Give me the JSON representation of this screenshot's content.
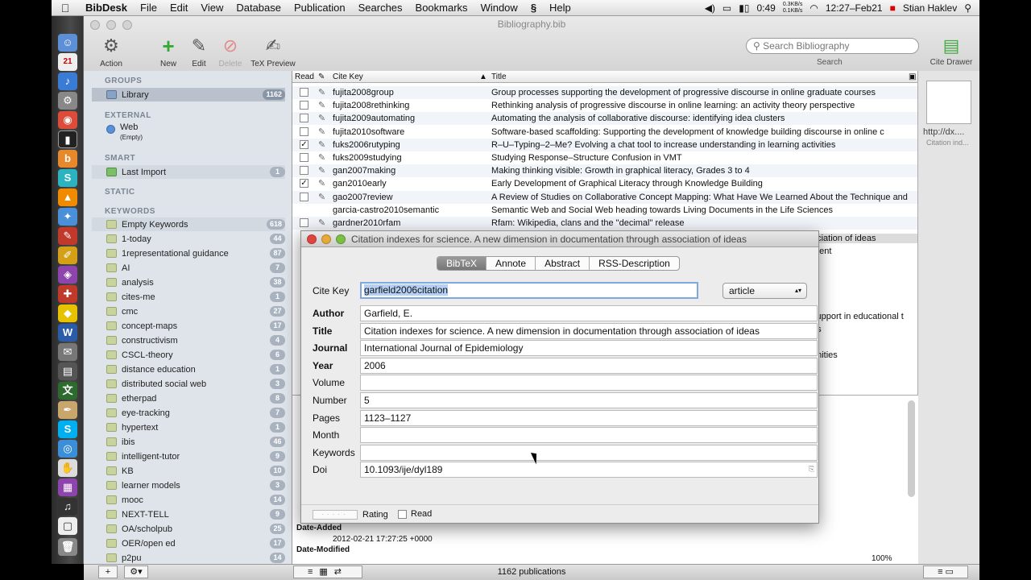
{
  "menubar": {
    "app_name": "BibDesk",
    "items": [
      "File",
      "Edit",
      "View",
      "Database",
      "Publication",
      "Searches",
      "Bookmarks",
      "Window",
      "Help"
    ],
    "battery": "0:49",
    "net_up": "0.3KB/s",
    "net_down": "0.1KB/s",
    "clock": "12:27–Feb21",
    "user": "Stian Haklev"
  },
  "window": {
    "title": "Bibliography.bib",
    "toolbar": {
      "action": "Action",
      "new": "New",
      "edit": "Edit",
      "delete": "Delete",
      "tex_preview": "TeX Preview",
      "search_placeholder": "Search Bibliography",
      "search_label": "Search",
      "cite_drawer": "Cite Drawer"
    }
  },
  "sidebar": {
    "groups_header": "GROUPS",
    "library": {
      "label": "Library",
      "count": "1162"
    },
    "external_header": "EXTERNAL",
    "web": {
      "label": "Web",
      "sub": "(Empty)"
    },
    "smart_header": "SMART",
    "last_import": {
      "label": "Last Import",
      "count": "1"
    },
    "static_header": "STATIC",
    "keywords_header": "KEYWORDS",
    "keywords": [
      {
        "label": "Empty Keywords",
        "count": "618"
      },
      {
        "label": "1-today",
        "count": "44"
      },
      {
        "label": "1representational guidance",
        "count": "87"
      },
      {
        "label": "AI",
        "count": "7"
      },
      {
        "label": "analysis",
        "count": "38"
      },
      {
        "label": "cites-me",
        "count": "1"
      },
      {
        "label": "cmc",
        "count": "27"
      },
      {
        "label": "concept-maps",
        "count": "17"
      },
      {
        "label": "constructivism",
        "count": "4"
      },
      {
        "label": "CSCL-theory",
        "count": "6"
      },
      {
        "label": "distance education",
        "count": "1"
      },
      {
        "label": "distributed social web",
        "count": "3"
      },
      {
        "label": "etherpad",
        "count": "8"
      },
      {
        "label": "eye-tracking",
        "count": "7"
      },
      {
        "label": "hypertext",
        "count": "1"
      },
      {
        "label": "ibis",
        "count": "46"
      },
      {
        "label": "intelligent-tutor",
        "count": "9"
      },
      {
        "label": "KB",
        "count": "10"
      },
      {
        "label": "learner models",
        "count": "3"
      },
      {
        "label": "mooc",
        "count": "14"
      },
      {
        "label": "NEXT-TELL",
        "count": "9"
      },
      {
        "label": "OA/scholpub",
        "count": "25"
      },
      {
        "label": "OER/open ed",
        "count": "17"
      },
      {
        "label": "p2pu",
        "count": "14"
      }
    ]
  },
  "table": {
    "headers": {
      "read": "Read",
      "cite_key": "Cite Key",
      "title": "Title"
    },
    "rows": [
      {
        "read": false,
        "key": "fujita2008group",
        "title": "Group processes supporting the development of progressive discourse in online graduate courses"
      },
      {
        "read": false,
        "key": "fujita2008rethinking",
        "title": "Rethinking analysis of progressive discourse in online learning: an activity theory perspective"
      },
      {
        "read": false,
        "key": "fujita2009automating",
        "title": "Automating the analysis of collaborative discourse: identifying idea clusters"
      },
      {
        "read": false,
        "key": "fujita2010software",
        "title": "Software-based scaffolding: Supporting the development of knowledge building discourse in online c"
      },
      {
        "read": true,
        "key": "fuks2006rutyping",
        "title": "R–U–Typing–2–Me? Evolving a chat tool to increase understanding in learning activities"
      },
      {
        "read": false,
        "key": "fuks2009studying",
        "title": "Studying Response–Structure Confusion in VMT"
      },
      {
        "read": false,
        "key": "gan2007making",
        "title": "Making thinking visible: Growth in graphical literacy, Grades 3 to 4"
      },
      {
        "read": true,
        "key": "gan2010early",
        "title": "Early Development of Graphical Literacy through Knowledge Building"
      },
      {
        "read": false,
        "key": "gao2007review",
        "title": "A Review of Studies on Collaborative Concept Mapping: What Have We Learned About the Technique and"
      },
      {
        "read": null,
        "key": "garcia-castro2010semantic",
        "title": "Semantic Web and Social Web heading towards Living Documents in the Life Sciences"
      },
      {
        "read": false,
        "key": "gardner2010rfam",
        "title": "Rfam: Wikipedia, clans and the \"decimal\" release"
      }
    ],
    "peek_texts": [
      "ociation of ideas",
      "ment",
      "support in educational t",
      "es",
      "unities"
    ]
  },
  "detail": {
    "date_added_label": "Date-Added",
    "date_added": "2012-02-21 17:27:25 +0000",
    "date_modified_label": "Date-Modified"
  },
  "drawer": {
    "url": "http://dx....",
    "sub": "Citation ind..."
  },
  "bottombar": {
    "status": "1162 publications",
    "zoom": "100%"
  },
  "editor": {
    "title": "Citation indexes for science. A new dimension in documentation through association of ideas",
    "tabs": [
      "BibTeX",
      "Annote",
      "Abstract",
      "RSS-Description"
    ],
    "cite_key_label": "Cite Key",
    "cite_key": "garfield2006citation",
    "type": "article",
    "fields": [
      {
        "label": "Author",
        "value": "Garfield, E.",
        "bold": true
      },
      {
        "label": "Title",
        "value": "Citation indexes for science. A new dimension in documentation through association of ideas",
        "bold": true
      },
      {
        "label": "Journal",
        "value": "International Journal of Epidemiology",
        "bold": true
      },
      {
        "label": "Year",
        "value": "2006",
        "bold": true
      },
      {
        "label": "Volume",
        "value": "",
        "bold": false
      },
      {
        "label": "Number",
        "value": "5",
        "bold": false
      },
      {
        "label": "Pages",
        "value": "1123–1127",
        "bold": false
      },
      {
        "label": "Month",
        "value": "",
        "bold": false
      },
      {
        "label": "Keywords",
        "value": "",
        "bold": false
      },
      {
        "label": "Doi",
        "value": "10.1093/ije/dyl189",
        "bold": false
      }
    ],
    "rating_label": "Rating",
    "read_label": "Read"
  }
}
